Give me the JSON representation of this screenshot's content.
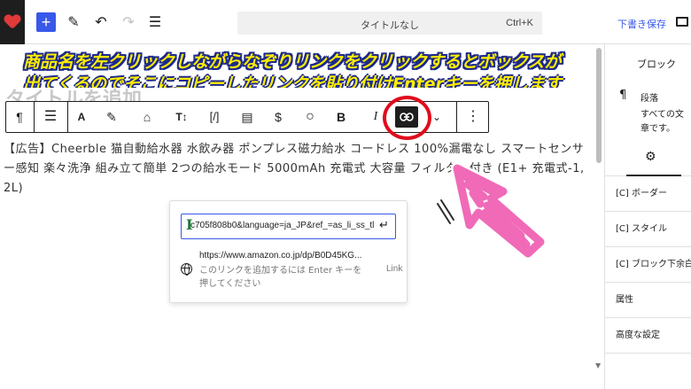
{
  "topbar": {
    "command_title": "タイトルなし",
    "command_shortcut": "Ctrl+K",
    "add_label": "+",
    "save_draft": "下書き保存"
  },
  "banner": {
    "line1": "商品名を左クリックしながらなぞりリンクをクリックするとボックスが",
    "line2": "出てくるのでそこにコピーしたリンクを貼り付けEnterキーを押します"
  },
  "editor": {
    "ghost_title": "タイトルを追加",
    "paragraph": "【広告】Cheerble 猫自動給水器 水飲み器 ポンプレス磁力給水 コードレス 100%漏電なし スマートセンサー感知 楽々洗浄 組み立て簡単 2つの給水モード 5000mAh 充電式 大容量 フィルター付き (E1+ 充電式-1, 2L)"
  },
  "block_toolbar": {
    "paragraph_glyph": "¶",
    "font_glyph": "A",
    "textsize_glyph": "T↕",
    "shortcode_glyph": "[/]",
    "bold_glyph": "B",
    "italic_glyph": "I"
  },
  "link_popover": {
    "input_value": "c705f808b0&language=ja_JP&ref_=as_li_ss_tl",
    "suggestion_url": "https://www.amazon.co.jp/dp/B0D45KG...",
    "suggestion_hint": "このリンクを追加するには Enter キーを押してください",
    "suggestion_type": "Link"
  },
  "sidebar": {
    "block_tab": "ブロック",
    "block_name": "段落",
    "block_desc": "すべての文章です。",
    "rows": [
      "[C] ボーダー",
      "[C] スタイル",
      "[C] ブロック下余白",
      "属性",
      "高度な設定"
    ]
  },
  "colors": {
    "accent": "#3858e9",
    "banner_text": "#ffee00",
    "banner_outline": "#1e2a8a",
    "highlight_circle": "#e00c1c",
    "scribble": "#f06ab8"
  },
  "icons": [
    "heart-logo-icon",
    "plus-icon",
    "pen-icon",
    "undo-icon",
    "redo-icon",
    "list-view-icon",
    "desktop-view-icon",
    "paragraph-icon",
    "align-icon",
    "font-icon",
    "highlighter-icon",
    "tag-icon",
    "text-size-icon",
    "shortcode-icon",
    "document-icon",
    "dollar-icon",
    "circle-icon",
    "bold-icon",
    "italic-icon",
    "link-icon",
    "chevron-down-icon",
    "more-options-icon",
    "enter-icon",
    "globe-icon",
    "gear-icon",
    "text-cursor-icon"
  ]
}
